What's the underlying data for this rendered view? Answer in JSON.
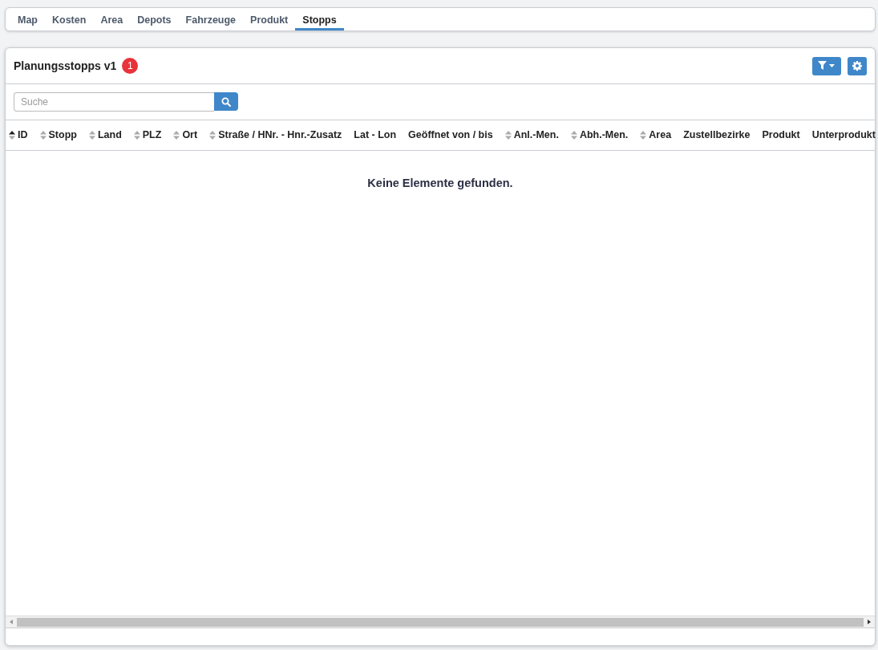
{
  "tabs": [
    {
      "label": "Map",
      "selected": false
    },
    {
      "label": "Kosten",
      "selected": false
    },
    {
      "label": "Area",
      "selected": false
    },
    {
      "label": "Depots",
      "selected": false
    },
    {
      "label": "Fahrzeuge",
      "selected": false
    },
    {
      "label": "Produkt",
      "selected": false
    },
    {
      "label": "Stopps",
      "selected": true
    }
  ],
  "panel": {
    "title": "Planungsstopps v1",
    "badge": "1"
  },
  "search": {
    "placeholder": "Suche"
  },
  "table": {
    "columns": [
      {
        "label": "ID",
        "sortable": true,
        "sorted": true
      },
      {
        "label": "Stopp",
        "sortable": true,
        "sorted": false
      },
      {
        "label": "Land",
        "sortable": true,
        "sorted": false
      },
      {
        "label": "PLZ",
        "sortable": true,
        "sorted": false
      },
      {
        "label": "Ort",
        "sortable": true,
        "sorted": false
      },
      {
        "label": "Straße / HNr. - Hnr.-Zusatz",
        "sortable": true,
        "sorted": false
      },
      {
        "label": "Lat - Lon",
        "sortable": false,
        "sorted": false
      },
      {
        "label": "Geöffnet von / bis",
        "sortable": false,
        "sorted": false
      },
      {
        "label": "Anl.-Men.",
        "sortable": true,
        "sorted": false
      },
      {
        "label": "Abh.-Men.",
        "sortable": true,
        "sorted": false
      },
      {
        "label": "Area",
        "sortable": true,
        "sorted": false
      },
      {
        "label": "Zustellbezirke",
        "sortable": false,
        "sorted": false
      },
      {
        "label": "Produkt",
        "sortable": false,
        "sorted": false
      },
      {
        "label": "Unterprodukt",
        "sortable": false,
        "sorted": false
      }
    ],
    "empty_message": "Keine Elemente gefunden."
  }
}
